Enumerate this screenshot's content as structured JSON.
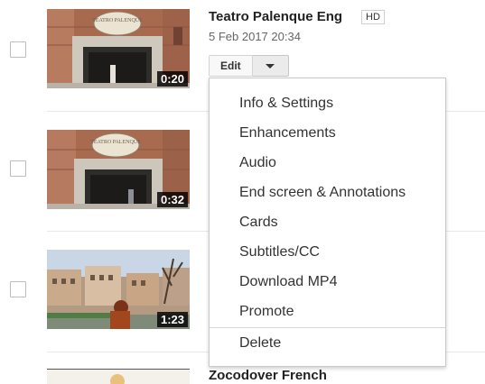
{
  "videos": [
    {
      "title": "Teatro Palenque Eng",
      "badge": "HD",
      "date": "5 Feb 2017 20:34",
      "duration": "0:20",
      "sign_text": "TEATRO PALENQUE"
    },
    {
      "duration": "0:32",
      "sign_text": "TEATRO PALENQUE"
    },
    {
      "duration": "1:23"
    },
    {
      "title": "Zocodover French"
    }
  ],
  "edit_button": {
    "label": "Edit"
  },
  "edit_menu": {
    "items": [
      "Info & Settings",
      "Enhancements",
      "Audio",
      "End screen & Annotations",
      "Cards",
      "Subtitles/CC",
      "Download MP4",
      "Promote"
    ],
    "delete_label": "Delete"
  },
  "colors": {
    "menu_border": "#c9c9c9",
    "text": "#333333",
    "badge_border": "#cfcfcf"
  }
}
